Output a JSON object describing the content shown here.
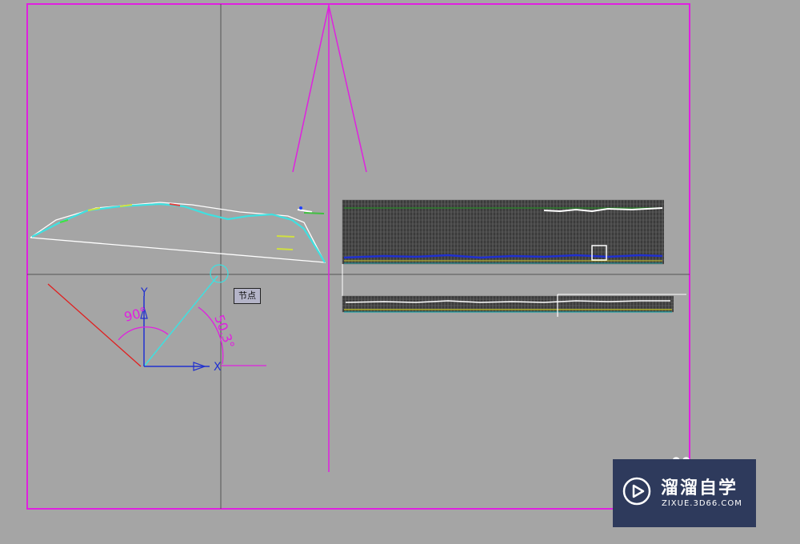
{
  "canvas": {
    "background": "#a5a5a5",
    "frame_color": "#e020e0",
    "axis_line_color": "#555555"
  },
  "ucs": {
    "y_label": "Y",
    "x_label": "X",
    "angle_1": "90°",
    "angle_2": "50.3°"
  },
  "tooltip": {
    "text": "节点"
  },
  "watermark": {
    "title": "溜溜自学",
    "url": "ZIXUE.3D66.COM",
    "logo": "play-icon"
  }
}
